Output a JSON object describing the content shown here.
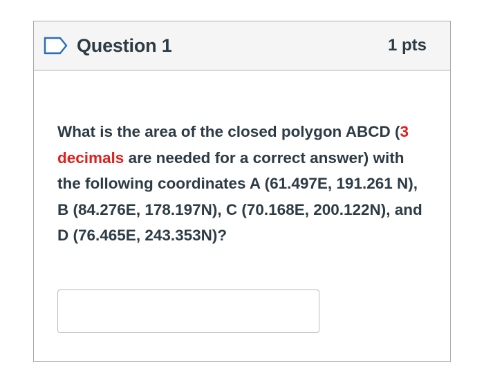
{
  "question": {
    "title": "Question 1",
    "points": "1 pts",
    "text_parts": [
      "What is the area of the closed polygon ABCD (",
      "3 decimals",
      " are needed for a correct answer) with the following coordinates A (61.497E, 191.261 N), B (84.276E, 178.197N), C (70.168E, 200.122N), and D (76.465E, 243.353N)?"
    ],
    "answer": {
      "value": "",
      "placeholder": ""
    }
  },
  "colors": {
    "header_bg": "#f5f5f5",
    "text": "#2d3b45",
    "highlight": "#e0201c",
    "flag_outline": "#2a6ebb",
    "border": "#a8a8a8"
  },
  "icons": {
    "flag": "flag-outline-icon"
  }
}
